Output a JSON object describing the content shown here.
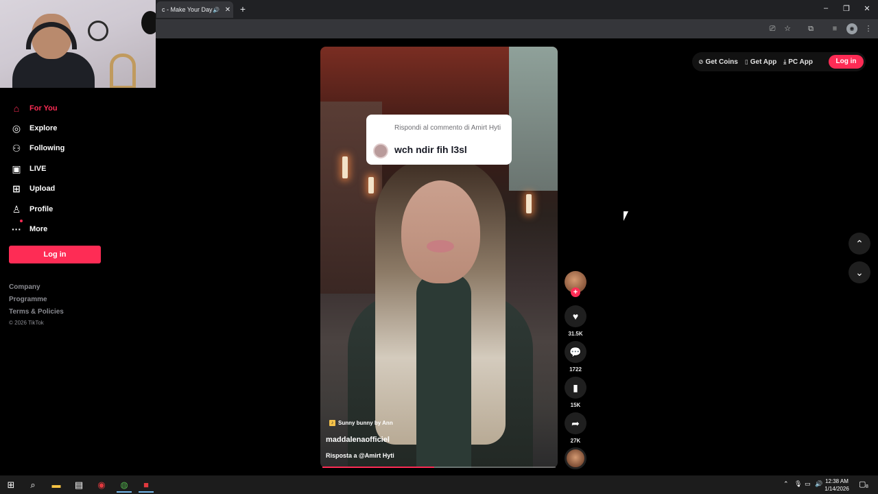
{
  "browser": {
    "tab_title": "c - Make Your Day",
    "new_tab_symbol": "+",
    "tab_close_symbol": "✕",
    "window_controls": [
      "–",
      "❐",
      "✕"
    ]
  },
  "sidebar": {
    "items": [
      {
        "label": "For You",
        "icon": "home-icon",
        "active": true
      },
      {
        "label": "Explore",
        "icon": "compass-icon",
        "active": false
      },
      {
        "label": "Following",
        "icon": "following-icon",
        "active": false
      },
      {
        "label": "LIVE",
        "icon": "live-icon",
        "active": false
      },
      {
        "label": "Upload",
        "icon": "upload-icon",
        "active": false
      },
      {
        "label": "Profile",
        "icon": "profile-icon",
        "active": false
      },
      {
        "label": "More",
        "icon": "more-icon",
        "active": false
      }
    ],
    "login_label": "Log in",
    "footer_links": [
      "Company",
      "Programme",
      "Terms & Policies"
    ],
    "copyright": "© 2026 TikTok"
  },
  "header": {
    "get_coins": "Get Coins",
    "get_app": "Get App",
    "pc_app": "PC App",
    "login_label": "Log in"
  },
  "video": {
    "comment_reply_to": "Rispondi al commento di Amirt Hyti",
    "comment_text": "wch ndir fih l3sl",
    "music": "Sunny bunny by Ann",
    "username": "maddalenaofficiel",
    "caption": "Risposta a @Amirt Hyti",
    "progress": 0.48
  },
  "actions": {
    "likes": "31.5K",
    "comments": "1722",
    "saves": "15K",
    "shares": "27K"
  },
  "taskbar": {
    "time": "12:38 AM",
    "date": "1/14/2026",
    "notification_count": "8"
  },
  "colors": {
    "accent": "#fe2c55",
    "background": "#000000"
  }
}
